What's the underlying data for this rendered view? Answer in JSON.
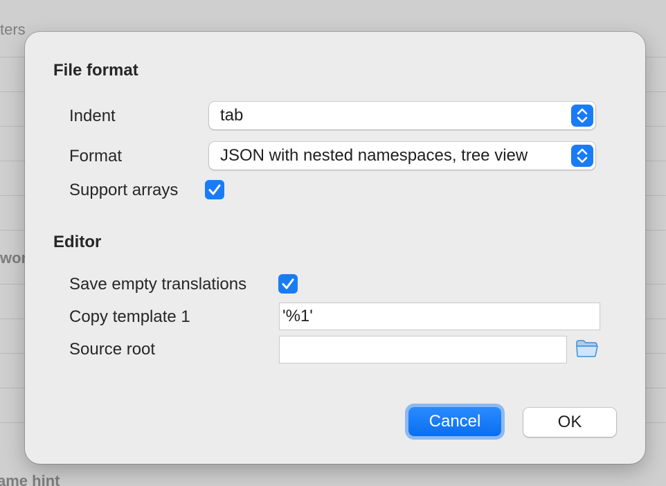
{
  "background": {
    "text_top": "ters",
    "text_mid": "wor",
    "text_bottom": "ame hint"
  },
  "file_format": {
    "title": "File format",
    "indent_label": "Indent",
    "indent_value": "tab",
    "format_label": "Format",
    "format_value": "JSON with nested namespaces, tree view",
    "support_arrays_label": "Support arrays",
    "support_arrays_checked": true
  },
  "editor": {
    "title": "Editor",
    "save_empty_label": "Save empty translations",
    "save_empty_checked": true,
    "copy_template_label": "Copy template 1",
    "copy_template_value": "'%1'",
    "source_root_label": "Source root",
    "source_root_value": ""
  },
  "buttons": {
    "cancel": "Cancel",
    "ok": "OK"
  },
  "colors": {
    "accent": "#1a7cf5",
    "dialog_bg": "#ececec"
  }
}
